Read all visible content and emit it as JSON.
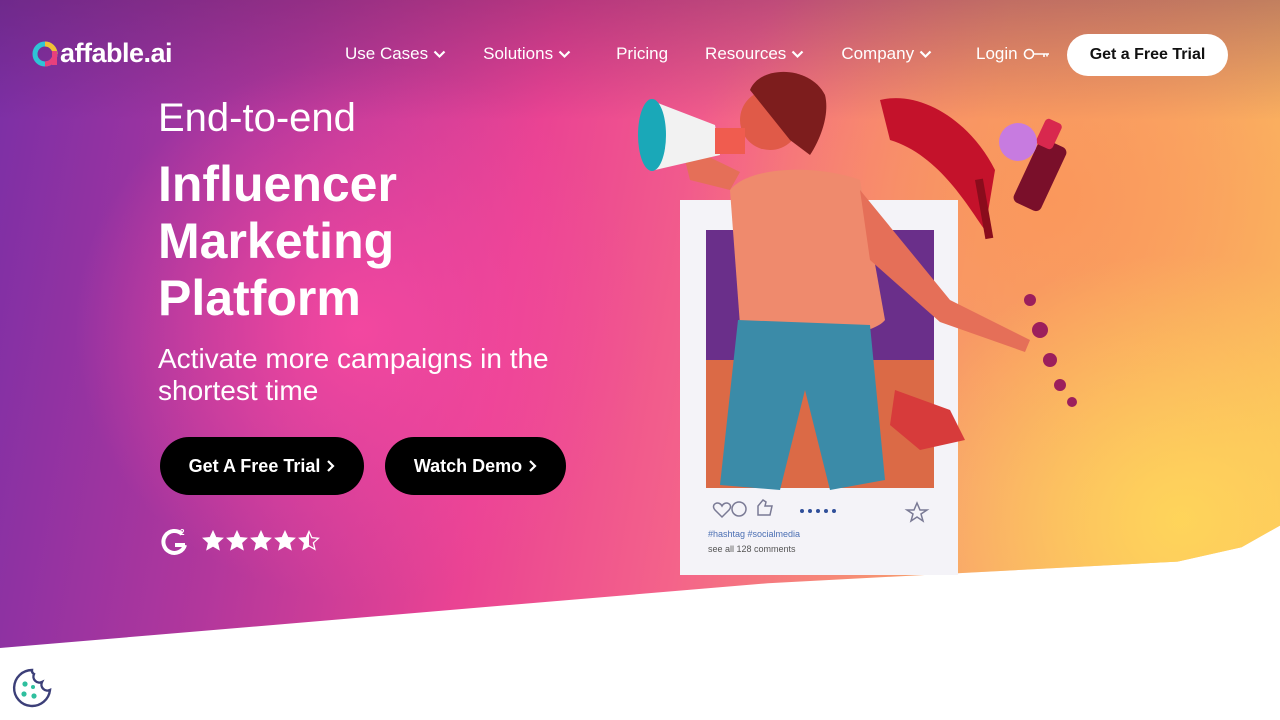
{
  "brand": {
    "name": "affable.ai"
  },
  "nav": {
    "items": [
      {
        "label": "Use Cases",
        "has_dropdown": true
      },
      {
        "label": "Solutions",
        "has_dropdown": true
      },
      {
        "label": "Pricing",
        "has_dropdown": false
      },
      {
        "label": "Resources",
        "has_dropdown": true
      },
      {
        "label": "Company",
        "has_dropdown": true
      }
    ],
    "login_label": "Login",
    "cta_label": "Get a Free Trial"
  },
  "hero": {
    "eyebrow": "End-to-end",
    "headline_lines": [
      "Influencer",
      "Marketing",
      "Platform"
    ],
    "subhead": "Activate more campaigns in the shortest time",
    "primary_button": "Get A Free Trial",
    "secondary_button": "Watch Demo",
    "rating": {
      "badge": "G2",
      "stars": 4.5,
      "max_stars": 5
    }
  },
  "post_card": {
    "hashtags": "#hashtag  #socialmedia",
    "comments_text": "see all 128 comments"
  },
  "colors": {
    "gradient_purple": "#7a2fa6",
    "gradient_pink": "#ea4393",
    "gradient_orange": "#f79a6e",
    "gradient_yellow": "#fbc35c",
    "button_black": "#000000",
    "cta_white": "#ffffff"
  },
  "icons": [
    "chevron-down-icon",
    "key-icon",
    "chevron-right-icon",
    "g2-logo-icon",
    "star-icon",
    "cookie-icon"
  ]
}
